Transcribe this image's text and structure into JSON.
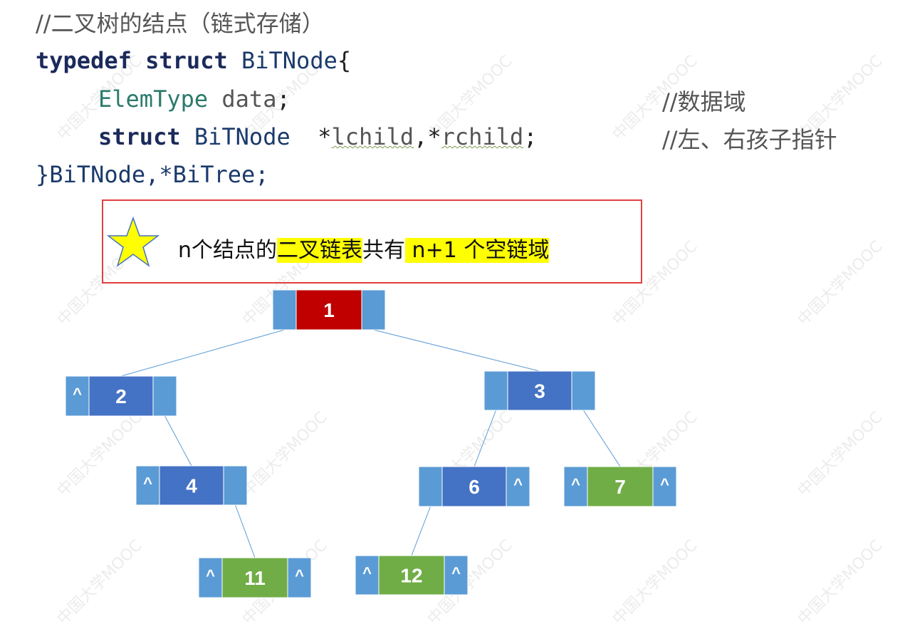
{
  "code": {
    "comment_line": "//二叉树的结点（链式存储）",
    "typedef_kw": "typedef",
    "struct_kw": "struct",
    "struct_name": "BiTNode",
    "open_brace": "{",
    "elem_type": "ElemType",
    "data_field": "data",
    "semicolon": ";",
    "struct_kw2": "struct",
    "struct_name2": "BiTNode",
    "star1": "*",
    "lchild": "lchild",
    "comma": ",",
    "star2": "*",
    "rchild": "rchild",
    "semicolon2": ";",
    "close_line": "}BiTNode,*BiTree;",
    "data_comment": "//数据域",
    "child_comment": "//左、右孩子指针"
  },
  "callout": {
    "part1": "n个结点的",
    "part2": "二叉链表",
    "part3": "共有",
    "part4": " n+1 个空链域"
  },
  "watermark": "中国大学MOOC",
  "tree": {
    "nodes": [
      {
        "id": "1",
        "label": "1",
        "color": "#c00000",
        "left": "",
        "right": ""
      },
      {
        "id": "2",
        "label": "2",
        "color": "#4472c4",
        "left": "^",
        "right": ""
      },
      {
        "id": "3",
        "label": "3",
        "color": "#4472c4",
        "left": "",
        "right": ""
      },
      {
        "id": "4",
        "label": "4",
        "color": "#4472c4",
        "left": "^",
        "right": ""
      },
      {
        "id": "6",
        "label": "6",
        "color": "#4472c4",
        "left": "",
        "right": "^"
      },
      {
        "id": "7",
        "label": "7",
        "color": "#70ad47",
        "left": "^",
        "right": "^"
      },
      {
        "id": "11",
        "label": "11",
        "color": "#70ad47",
        "left": "^",
        "right": "^"
      },
      {
        "id": "12",
        "label": "12",
        "color": "#70ad47",
        "left": "^",
        "right": "^"
      }
    ],
    "edges": [
      [
        "1",
        "2"
      ],
      [
        "1",
        "3"
      ],
      [
        "2",
        "4"
      ],
      [
        "3",
        "6"
      ],
      [
        "3",
        "7"
      ],
      [
        "4",
        "11"
      ],
      [
        "6",
        "12"
      ]
    ]
  }
}
